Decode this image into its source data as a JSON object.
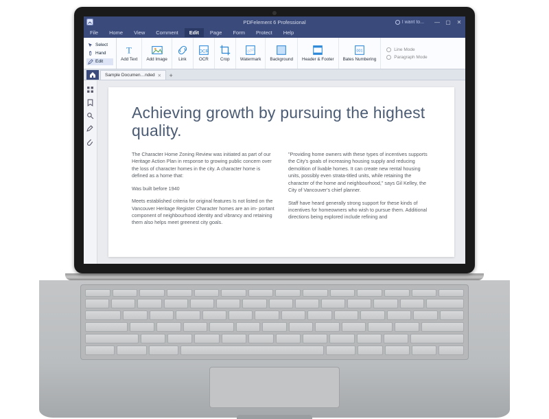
{
  "window": {
    "app_title": "PDFelement 6 Professional",
    "search_hint": "I want to...",
    "controls": {
      "min": "—",
      "max": "▢",
      "close": "✕"
    }
  },
  "menu": {
    "items": [
      "File",
      "Home",
      "View",
      "Comment",
      "Edit",
      "Page",
      "Form",
      "Protect",
      "Help"
    ],
    "active_index": 4
  },
  "ribbon": {
    "side_modes": [
      {
        "label": "Select",
        "icon": "cursor"
      },
      {
        "label": "Hand",
        "icon": "hand"
      },
      {
        "label": "Edit",
        "icon": "edit",
        "active": true
      }
    ],
    "groups": [
      {
        "label": "Add Text",
        "icon": "text"
      },
      {
        "label": "Add Image",
        "icon": "image"
      },
      {
        "label": "Link",
        "icon": "link"
      },
      {
        "label": "OCR",
        "icon": "ocr"
      },
      {
        "label": "Crop",
        "icon": "crop"
      },
      {
        "label": "Watermark",
        "icon": "watermark"
      },
      {
        "label": "Background",
        "icon": "background"
      },
      {
        "label": "Header & Footer",
        "icon": "headerfooter"
      },
      {
        "label": "Bates Numbering",
        "icon": "bates"
      }
    ],
    "view_modes": [
      "Line Mode",
      "Paragraph Mode"
    ]
  },
  "tabs": {
    "home_icon": "home",
    "documents": [
      {
        "name": "Sample Documen…nded"
      }
    ],
    "add_label": "+"
  },
  "side_tools": [
    "thumbnails",
    "bookmark",
    "search",
    "annotations",
    "attachments"
  ],
  "document": {
    "heading": "Achieving growth by pursuing the highest quality.",
    "left_column": [
      "The Character Home Zoning Review was initiated as part of our Heritage Action Plan in response to growing public concern over the loss of character homes in the city.  A character home is defined as a home that:",
      "Was built before 1940",
      "Meets established criteria for original features Is not listed on the Vancouver Heritage Register Character homes are an im- portant component of neighbourhood identity and vibrancy and retaining them also helps meet greenest city goals."
    ],
    "right_column": [
      "\"Providing home owners with these types of incentives supports the City's goals of increasing housing supply and reducing demolition of livable homes.  It can create new rental housing units, possibly even strata-titled units, while retaining the character of the home and neighbourhood,\" says Gil Kelley, the City of Vancouver's chief planner.",
      "Staff have heard generally strong support for these kinds of incentives for homeowners who wish to pursue them. Additional directions being explored include refining and"
    ]
  },
  "colors": {
    "brand": "#3a4a7a",
    "doc_heading": "#4a5b73"
  }
}
